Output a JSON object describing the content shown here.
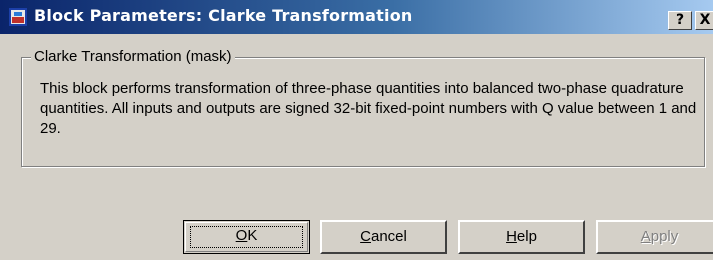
{
  "window": {
    "title": "Block Parameters: Clarke Transformation",
    "help_glyph": "?",
    "close_glyph": "X"
  },
  "group": {
    "legend": "Clarke Transformation (mask)",
    "description": "This block performs transformation of three-phase quantities into balanced two-phase quadrature quantities. All inputs and outputs are signed 32-bit fixed-point numbers with Q value between 1 and 29."
  },
  "buttons": {
    "ok": {
      "accel": "O",
      "rest": "K"
    },
    "cancel": {
      "accel": "C",
      "rest": "ancel"
    },
    "help": {
      "accel": "H",
      "rest": "elp"
    },
    "apply": {
      "accel": "A",
      "rest": "pply",
      "disabled": true
    }
  },
  "colors": {
    "titlebar_start": "#0a246a",
    "titlebar_end": "#a6caf0",
    "face": "#d4d0c8"
  }
}
